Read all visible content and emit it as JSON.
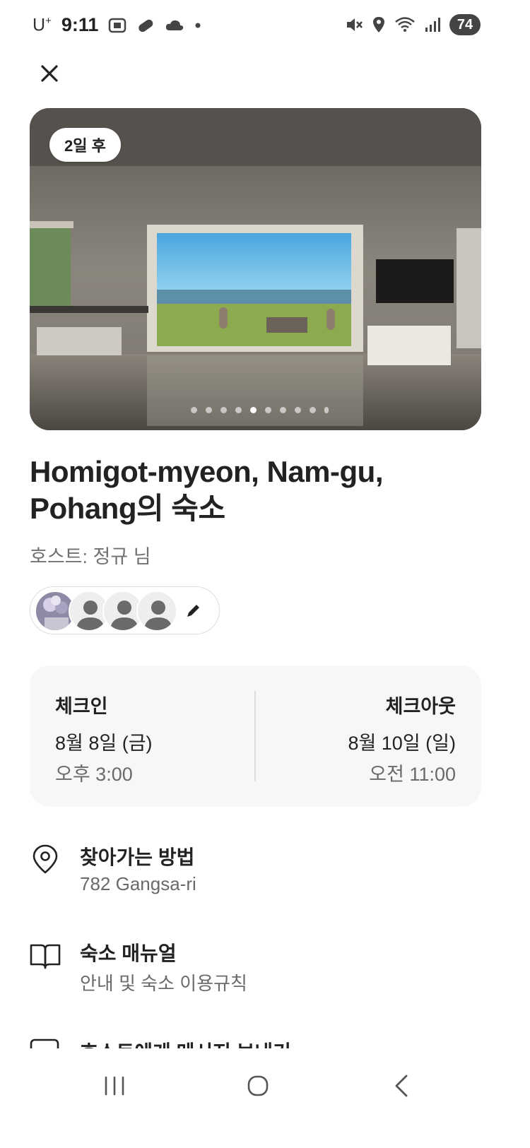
{
  "status_bar": {
    "carrier": "U",
    "carrier_sup": "+",
    "time": "9:11",
    "battery": "74"
  },
  "photo": {
    "badge": "2일 후",
    "page_count": 10,
    "active_index": 4
  },
  "listing": {
    "title_line1": "Homigot-myeon, Nam-gu,",
    "title_line2": "Pohang의 숙소",
    "host": "호스트: 정규 님"
  },
  "check": {
    "in_label": "체크인",
    "in_date": "8월 8일 (금)",
    "in_time": "오후 3:00",
    "out_label": "체크아웃",
    "out_date": "8월 10일 (일)",
    "out_time": "오전 11:00"
  },
  "rows": {
    "directions": {
      "title": "찾아가는 방법",
      "subtitle": "782 Gangsa-ri",
      "icon": "location-pin-icon"
    },
    "manual": {
      "title": "숙소 매뉴얼",
      "subtitle": "안내 및 숙소 이용규칙",
      "icon": "book-icon"
    },
    "message": {
      "title": "호스트에게 메시지 보내기",
      "icon": "message-icon"
    }
  },
  "colors": {
    "text_primary": "#222222",
    "text_secondary": "#6a6a6a",
    "card_bg": "#f7f7f7"
  }
}
